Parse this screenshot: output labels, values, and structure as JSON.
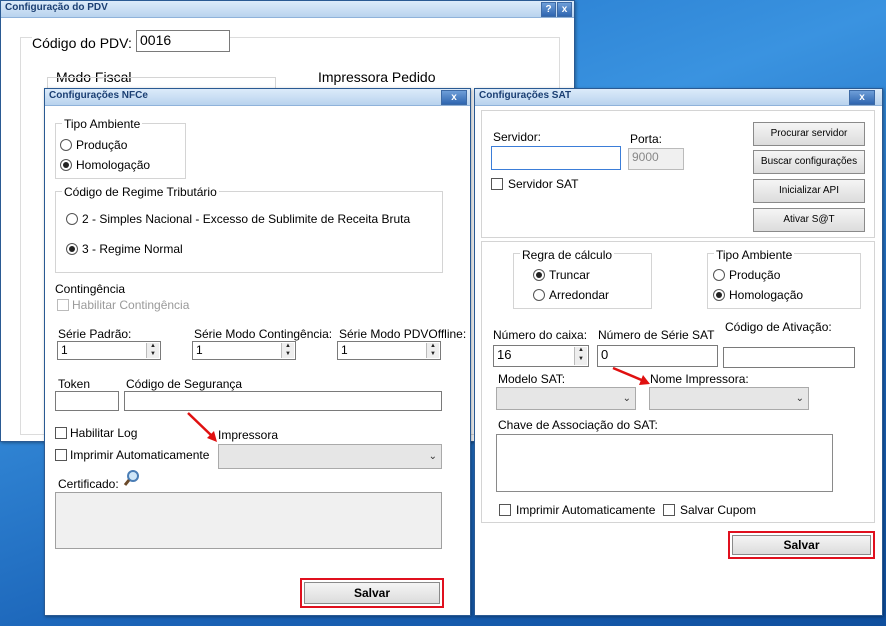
{
  "pdv_window": {
    "title": "Configuração do PDV",
    "help_glyph": "?",
    "close_glyph": "x",
    "codigo_label": "Código do PDV:",
    "codigo_value": "0016",
    "modo_fiscal": "Modo Fiscal",
    "impressora_pedido": "Impressora Pedido"
  },
  "nfce": {
    "title": "Configurações NFCe",
    "close_glyph": "x",
    "tipo_ambiente": {
      "label": "Tipo Ambiente",
      "options": [
        "Produção",
        "Homologação"
      ],
      "selected": 1
    },
    "regime": {
      "label": "Código de Regime Tributário",
      "options": [
        "2 - Simples Nacional - Excesso de Sublimite de Receita Bruta",
        "3 - Regime Normal"
      ],
      "selected": 1
    },
    "contingencia_label": "Contingência",
    "habilitar_contingencia": "Habilitar Contingência",
    "serie_padrao_label": "Série Padrão:",
    "serie_padrao_value": "1",
    "serie_contingencia_label": "Série Modo Contingência:",
    "serie_contingencia_value": "1",
    "serie_offline_label": "Série Modo PDVOffline:",
    "serie_offline_value": "1",
    "token_label": "Token",
    "token_value": "",
    "seguranca_label": "Código de Segurança",
    "seguranca_value": "",
    "habilitar_log": "Habilitar Log",
    "imprimir_auto": "Imprimir Automaticamente",
    "impressora_label": "Impressora",
    "impressora_value": "",
    "certificado_label": "Certificado:",
    "certificado_value": "",
    "salvar": "Salvar"
  },
  "sat": {
    "title": "Configurações SAT",
    "close_glyph": "x",
    "servidor_label": "Servidor:",
    "servidor_value": "",
    "porta_label": "Porta:",
    "porta_value": "9000",
    "servidor_sat": "Servidor SAT",
    "buttons": [
      "Procurar servidor",
      "Buscar configurações",
      "Inicializar API",
      "Ativar S@T"
    ],
    "regra": {
      "label": "Regra de cálculo",
      "options": [
        "Truncar",
        "Arredondar"
      ],
      "selected": 0
    },
    "tipo_ambiente": {
      "label": "Tipo Ambiente",
      "options": [
        "Produção",
        "Homologação"
      ],
      "selected": 1
    },
    "numero_caixa_label": "Número do caixa:",
    "numero_caixa_value": "16",
    "numero_serie_label": "Número de Série SAT",
    "numero_serie_value": "0",
    "codigo_ativacao_label": "Código de Ativação:",
    "codigo_ativacao_value": "",
    "modelo_label": "Modelo SAT:",
    "modelo_value": "",
    "nome_impressora_label": "Nome Impressora:",
    "nome_impressora_value": "",
    "chave_label": "Chave de Associação do SAT:",
    "chave_value": "",
    "imprimir_auto": "Imprimir Automaticamente",
    "salvar_cupom": "Salvar Cupom",
    "salvar": "Salvar"
  },
  "icons": {
    "search": "magnifier-icon",
    "arrow": "red-arrow"
  },
  "colors": {
    "highlight": "#e0101e",
    "titlebar": "#b9d3ee"
  }
}
